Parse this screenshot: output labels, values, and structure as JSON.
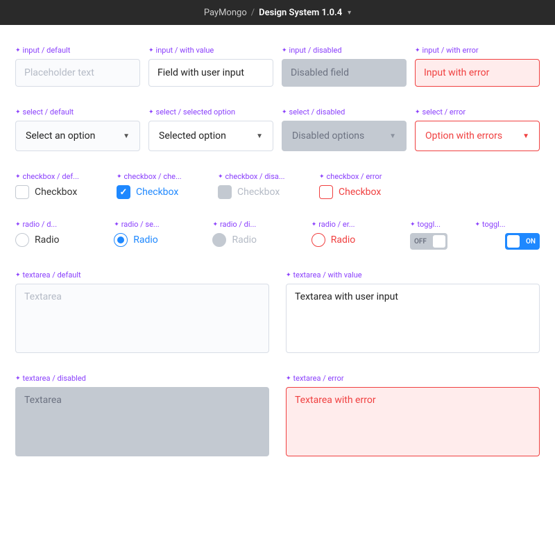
{
  "topbar": {
    "org": "PayMongo",
    "project": "Design System 1.0.4"
  },
  "inputs": {
    "default": {
      "variant": "input / default",
      "placeholder": "Placeholder text"
    },
    "withValue": {
      "variant": "input / with value",
      "value": "Field with user input"
    },
    "disabled": {
      "variant": "input / disabled",
      "value": "Disabled field"
    },
    "error": {
      "variant": "input / with error",
      "value": "Input with error"
    }
  },
  "selects": {
    "default": {
      "variant": "select / default",
      "text": "Select an option"
    },
    "selected": {
      "variant": "select / selected option",
      "text": "Selected option"
    },
    "disabled": {
      "variant": "select / disabled",
      "text": "Disabled options"
    },
    "error": {
      "variant": "select / error",
      "text": "Option with errors"
    }
  },
  "checkboxes": {
    "default": {
      "variant": "checkbox / def...",
      "label": "Checkbox"
    },
    "checked": {
      "variant": "checkbox / che...",
      "label": "Checkbox"
    },
    "disabled": {
      "variant": "checkbox / disa...",
      "label": "Checkbox"
    },
    "error": {
      "variant": "checkbox / error",
      "label": "Checkbox"
    }
  },
  "radios": {
    "default": {
      "variant": "radio / d...",
      "label": "Radio"
    },
    "selected": {
      "variant": "radio / se...",
      "label": "Radio"
    },
    "disabled": {
      "variant": "radio / di...",
      "label": "Radio"
    },
    "error": {
      "variant": "radio / er...",
      "label": "Radio"
    }
  },
  "toggles": {
    "off": {
      "variant": "toggl...",
      "label": "OFF"
    },
    "on": {
      "variant": "toggl...",
      "label": "ON"
    }
  },
  "textareas": {
    "default": {
      "variant": "textarea / default",
      "placeholder": "Textarea"
    },
    "withValue": {
      "variant": "textarea / with value",
      "value": "Textarea with user input"
    },
    "disabled": {
      "variant": "textarea / disabled",
      "value": "Textarea"
    },
    "error": {
      "variant": "textarea / error",
      "value": "Textarea with error"
    }
  }
}
